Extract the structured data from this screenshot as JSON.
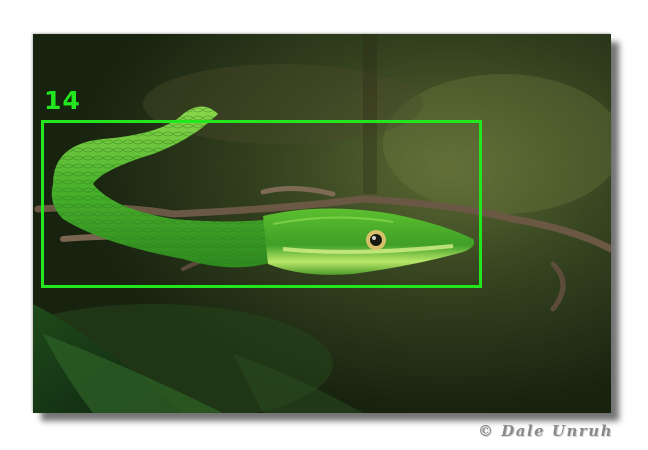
{
  "annotation": {
    "label": "14",
    "color": "#22e61e"
  },
  "watermark": {
    "text": "© Dale Unruh"
  }
}
